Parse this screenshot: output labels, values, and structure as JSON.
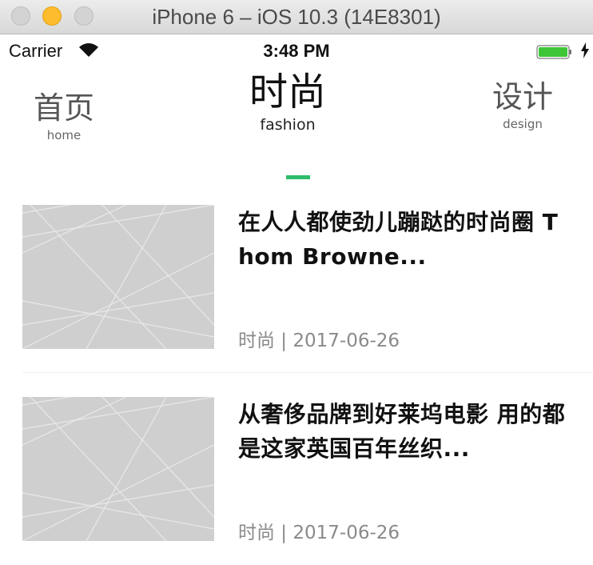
{
  "window": {
    "title": "iPhone 6 – iOS 10.3 (14E8301)"
  },
  "status_bar": {
    "carrier": "Carrier",
    "time": "3:48 PM",
    "battery_color": "#3ec638"
  },
  "tabs": [
    {
      "zh": "首页",
      "en": "home"
    },
    {
      "zh": "时尚",
      "en": "fashion"
    },
    {
      "zh": "设计",
      "en": "design"
    }
  ],
  "active_tab": "fashion",
  "accent_color": "#2ebd6a",
  "articles": [
    {
      "title": "在人人都使劲儿蹦跶的时尚圈  Thom Browne...",
      "category": "时尚",
      "date": "2017-06-26"
    },
    {
      "title": "从奢侈品牌到好莱坞电影 用的都是这家英国百年丝织...",
      "category": "时尚",
      "date": "2017-06-26"
    }
  ]
}
